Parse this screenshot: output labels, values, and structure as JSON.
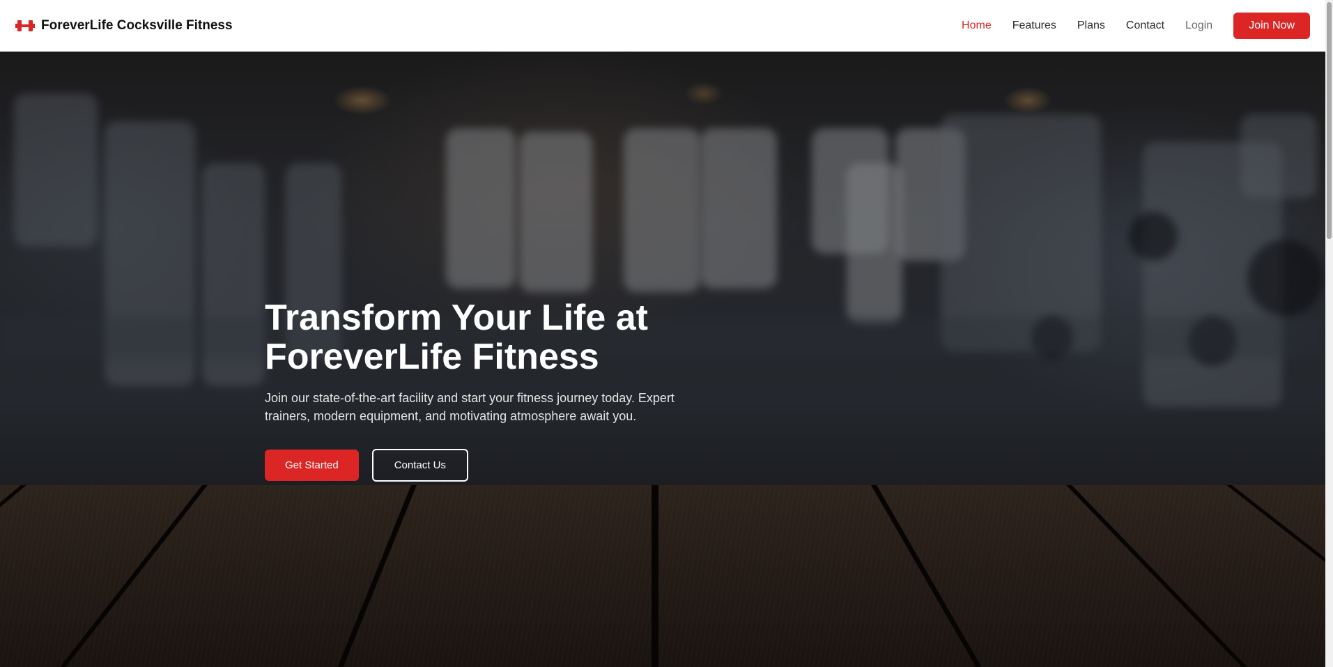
{
  "brand": {
    "name": "ForeverLife Cocksville Fitness",
    "icon": "dumbbell-icon",
    "accent_color": "#dc2626"
  },
  "nav": {
    "items": [
      {
        "label": "Home",
        "active": true
      },
      {
        "label": "Features"
      },
      {
        "label": "Plans"
      },
      {
        "label": "Contact"
      },
      {
        "label": "Login"
      }
    ],
    "cta_label": "Join Now"
  },
  "hero": {
    "title_line1": "Transform Your Life at",
    "title_line2": "ForeverLife Fitness",
    "subtitle": "Join our state-of-the-art facility and start your fitness journey today. Expert trainers, modern equipment, and motivating atmosphere await you.",
    "primary_button": "Get Started",
    "secondary_button": "Contact Us"
  }
}
